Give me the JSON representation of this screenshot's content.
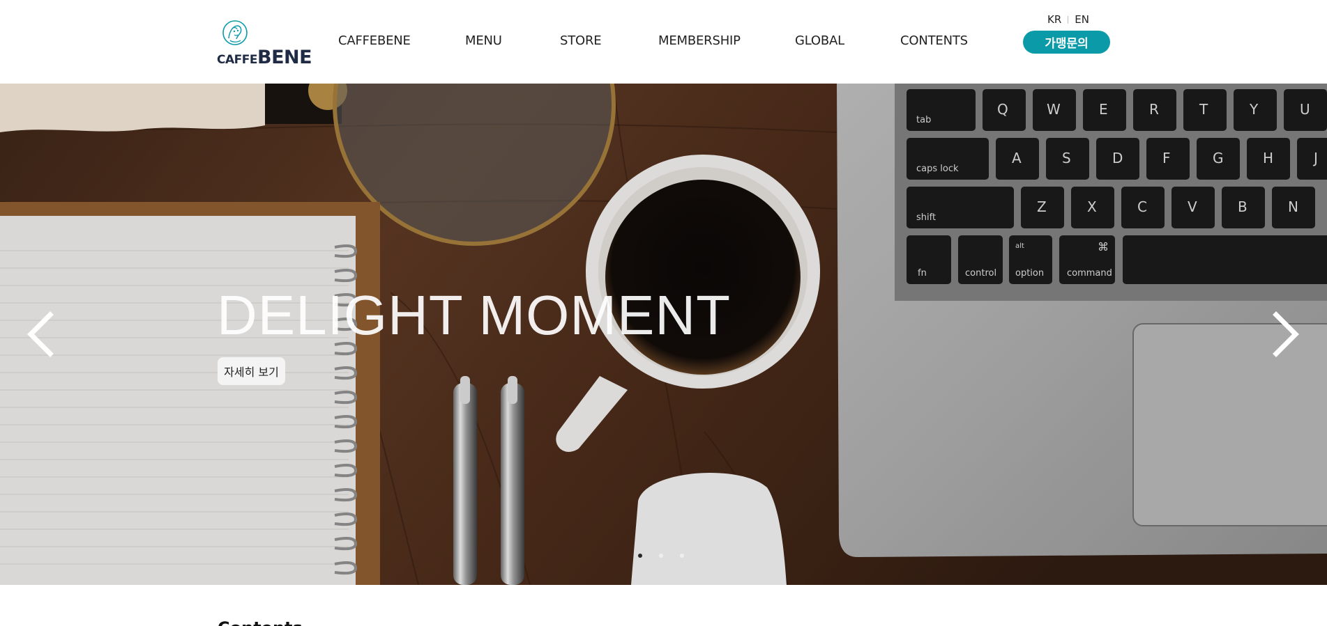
{
  "header": {
    "logo": {
      "small": "CAFFE",
      "big": "BENE"
    },
    "nav": [
      "CAFFEBENE",
      "MENU",
      "STORE",
      "MEMBERSHIP",
      "GLOBAL",
      "CONTENTS"
    ],
    "lang": {
      "kr": "KR",
      "en": "EN"
    },
    "franchise_button": "가맹문의",
    "accent_color": "#0a9aa8"
  },
  "hero": {
    "title": "DELIGHT MOMENT",
    "button": "자세히 보기",
    "slides": 3,
    "active_slide": 1,
    "keyboard_keys": {
      "row1": [
        "tab",
        "Q",
        "W",
        "E",
        "R",
        "T",
        "Y",
        "U"
      ],
      "row2": [
        "caps lock",
        "A",
        "S",
        "D",
        "F",
        "G",
        "H",
        "J"
      ],
      "row3": [
        "shift",
        "Z",
        "X",
        "C",
        "V",
        "B",
        "N"
      ],
      "row4": [
        "fn",
        "control",
        "alt",
        "option",
        "⌘",
        "command"
      ]
    }
  },
  "content": {
    "section_title": "Contents"
  }
}
